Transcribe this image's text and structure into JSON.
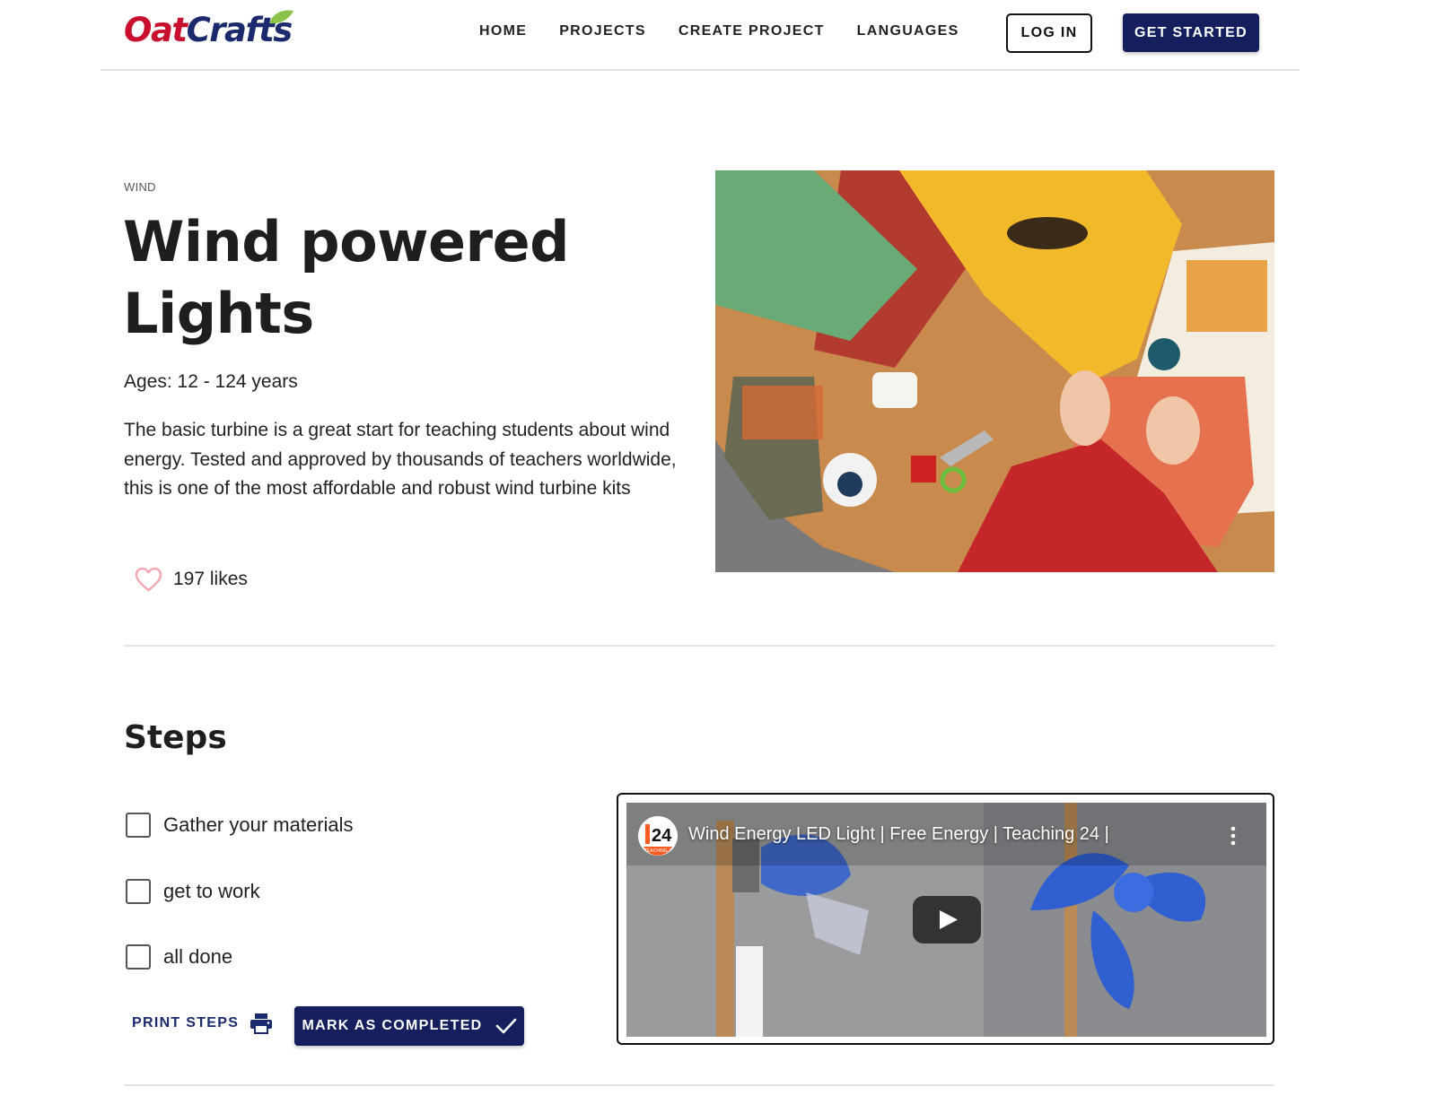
{
  "brand": {
    "part1": "Oat",
    "part2": "Crafts",
    "colors": {
      "oat": "#c8102e",
      "crafts": "#1a2a6c",
      "leaf": "#8bc34a"
    }
  },
  "nav": {
    "items": [
      "HOME",
      "PROJECTS",
      "CREATE PROJECT",
      "LANGUAGES"
    ]
  },
  "auth": {
    "login_label": "LOG IN",
    "get_started_label": "GET STARTED"
  },
  "project": {
    "category": "WIND",
    "title": "Wind powered Lights",
    "ages": "Ages: 12 - 124 years",
    "description": "The basic turbine is a great start for teaching students about wind energy. Tested and approved by thousands of teachers worldwide, this is one of the most affordable and robust wind turbine kits",
    "likes": "197 likes"
  },
  "steps": {
    "title": "Steps",
    "items": [
      "Gather your materials",
      "get to work",
      "all done"
    ],
    "print_label": "PRINT STEPS",
    "complete_label": "MARK AS COMPLETED"
  },
  "video": {
    "title": "Wind Energy LED Light | Free Energy | Teaching 24 |",
    "channel_badge": "24",
    "channel_sub": "TEACHING 24"
  },
  "theme": {
    "primary": "#161f5e",
    "divider": "#e3e3e3",
    "heart": "#f4a6b3"
  }
}
